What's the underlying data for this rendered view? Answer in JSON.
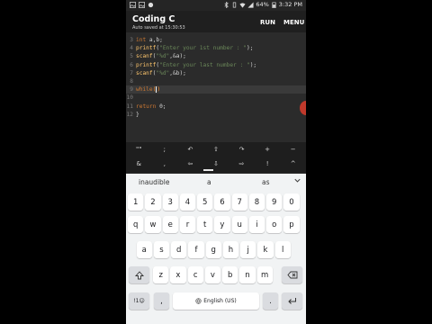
{
  "status": {
    "battery": "64%",
    "time": "3:32 PM"
  },
  "app": {
    "title": "Coding C",
    "subtitle": "Auto saved at 15:30:53",
    "run_label": "RUN",
    "menu_label": "MENU"
  },
  "code_lines": [
    {
      "num": "3",
      "tokens": [
        {
          "t": "int ",
          "c": "kw"
        },
        {
          "t": "a,b;",
          "c": "plain"
        }
      ]
    },
    {
      "num": "4",
      "tokens": [
        {
          "t": "printf",
          "c": "fn"
        },
        {
          "t": "(",
          "c": "plain"
        },
        {
          "t": "\"Enter your 1st number : \"",
          "c": "str"
        },
        {
          "t": ");",
          "c": "plain"
        }
      ]
    },
    {
      "num": "5",
      "tokens": [
        {
          "t": "scanf",
          "c": "fn"
        },
        {
          "t": "(",
          "c": "plain"
        },
        {
          "t": "\"%d\"",
          "c": "str"
        },
        {
          "t": ",&a);",
          "c": "plain"
        }
      ]
    },
    {
      "num": "6",
      "tokens": [
        {
          "t": "printf",
          "c": "fn"
        },
        {
          "t": "(",
          "c": "plain"
        },
        {
          "t": "\"Enter your last number : \"",
          "c": "str"
        },
        {
          "t": ");",
          "c": "plain"
        }
      ]
    },
    {
      "num": "7",
      "tokens": [
        {
          "t": "scanf",
          "c": "fn"
        },
        {
          "t": "(",
          "c": "plain"
        },
        {
          "t": "\"%d\"",
          "c": "str"
        },
        {
          "t": ",&b);",
          "c": "plain"
        }
      ]
    },
    {
      "num": "8",
      "tokens": []
    },
    {
      "num": "9",
      "tokens": [
        {
          "t": "while",
          "c": "kw"
        },
        {
          "t": "(",
          "c": "paren"
        },
        {
          "t": "CURSOR",
          "c": "cursor"
        },
        {
          "t": ")",
          "c": "paren"
        }
      ],
      "active": true
    },
    {
      "num": "10",
      "tokens": []
    },
    {
      "num": "11",
      "tokens": [
        {
          "t": "return ",
          "c": "kw"
        },
        {
          "t": "0;",
          "c": "plain"
        }
      ]
    },
    {
      "num": "12",
      "tokens": [
        {
          "t": "}",
          "c": "plain"
        }
      ]
    }
  ],
  "symbols_row1": [
    "\"\"",
    ";",
    "↶",
    "⇧",
    "↷",
    "+",
    "−"
  ],
  "symbols_row2": [
    "&",
    ",",
    "⇦",
    "⇩",
    "⇨",
    "!",
    "^"
  ],
  "suggestions": [
    "inaudible",
    "a",
    "as"
  ],
  "keyboard": {
    "row_numbers": [
      "1",
      "2",
      "3",
      "4",
      "5",
      "6",
      "7",
      "8",
      "9",
      "0"
    ],
    "row1": [
      "q",
      "w",
      "e",
      "r",
      "t",
      "y",
      "u",
      "i",
      "o",
      "p"
    ],
    "row2": [
      "a",
      "s",
      "d",
      "f",
      "g",
      "h",
      "j",
      "k",
      "l"
    ],
    "row3": [
      "z",
      "x",
      "c",
      "v",
      "b",
      "n",
      "m"
    ],
    "sym_key": "!1☺",
    "comma": ",",
    "space_label": "English (US)",
    "period": "."
  }
}
